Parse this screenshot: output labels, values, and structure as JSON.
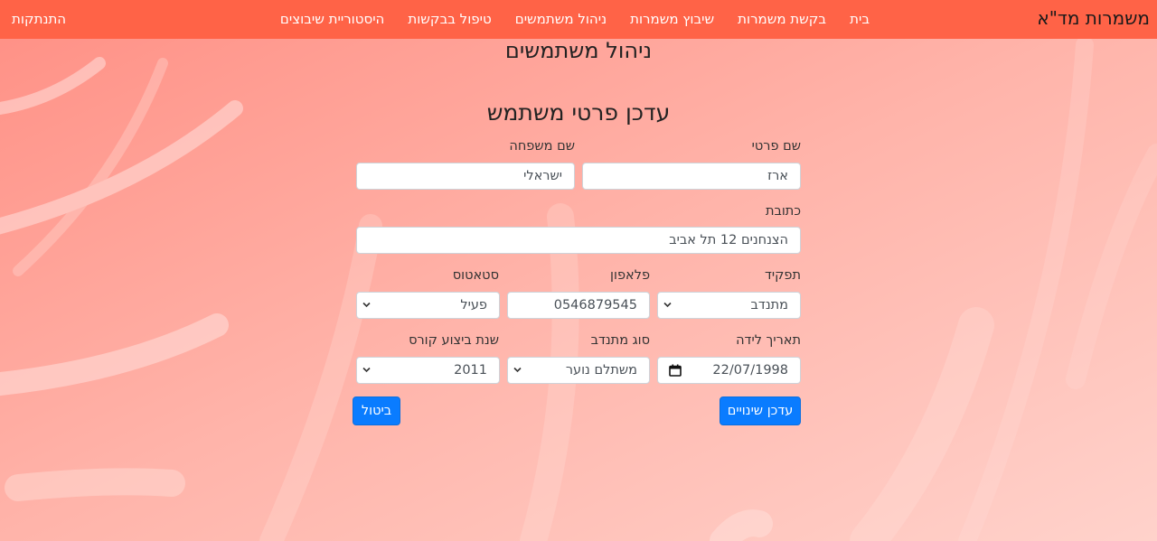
{
  "navbar": {
    "brand": "משמרות מד\"א",
    "links": [
      "בית",
      "בקשת משמרות",
      "שיבוץ משמרות",
      "ניהול משתמשים",
      "טיפול בבקשות",
      "היסטוריית שיבוצים"
    ],
    "logout": "התנתקות"
  },
  "page": {
    "title": "ניהול משתמשים"
  },
  "form": {
    "title": "עדכן פרטי משתמש",
    "first_name": {
      "label": "שם פרטי",
      "value": "ארז"
    },
    "last_name": {
      "label": "שם משפחה",
      "value": "ישראלי"
    },
    "address": {
      "label": "כתובת",
      "value": "הצנחנים 12 תל אביב"
    },
    "role": {
      "label": "תפקיד",
      "value": "מתנדב"
    },
    "phone": {
      "label": "פלאפון",
      "value": "0546879545"
    },
    "status": {
      "label": "סטאטוס",
      "value": "פעיל"
    },
    "birth_date": {
      "label": "תאריך לידה",
      "value": "22/07/1998"
    },
    "volunteer_type": {
      "label": "סוג מתנדב",
      "value": "משתלם נוער"
    },
    "course_year": {
      "label": "שנת ביצוע קורס",
      "value": "2011"
    },
    "save_label": "עדכן שינויים",
    "cancel_label": "ביטול"
  },
  "colors": {
    "navbar": "#ff6347",
    "primary_button": "#0a7cff",
    "background": "#ffc3bb"
  },
  "icons": {
    "select": "chevron-down-icon",
    "date": "calendar-icon"
  }
}
